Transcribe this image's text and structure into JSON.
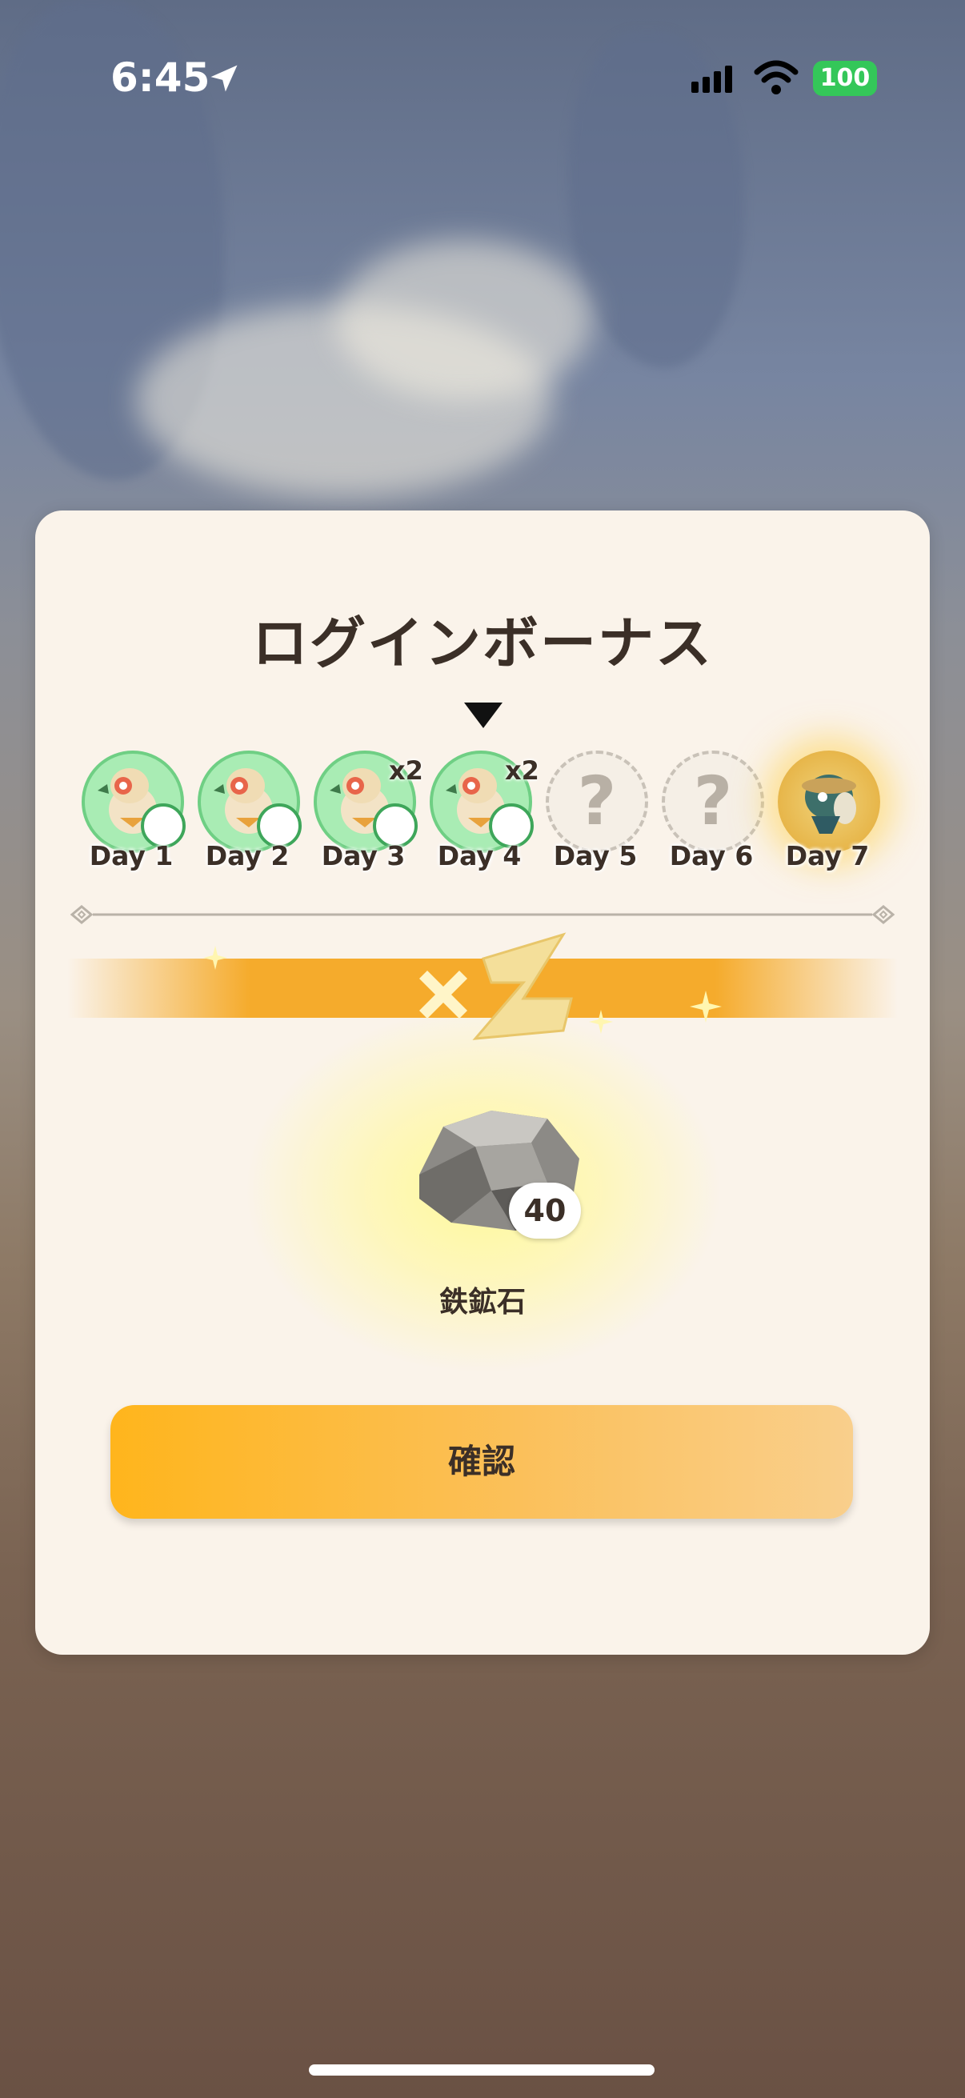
{
  "status_bar": {
    "time": "6:45",
    "battery": "100",
    "icons": [
      "location-arrow-icon",
      "cellular-signal-icon",
      "wifi-icon",
      "battery-icon"
    ]
  },
  "modal": {
    "title": "ログインボーナス",
    "days": [
      {
        "label": "Day 1",
        "state": "claimed",
        "multiplier": ""
      },
      {
        "label": "Day 2",
        "state": "claimed",
        "multiplier": ""
      },
      {
        "label": "Day 3",
        "state": "claimed",
        "multiplier": "x2"
      },
      {
        "label": "Day 4",
        "state": "current",
        "multiplier": "x2"
      },
      {
        "label": "Day 5",
        "state": "unknown",
        "mark": "?"
      },
      {
        "label": "Day 6",
        "state": "unknown",
        "mark": "?"
      },
      {
        "label": "Day 7",
        "state": "special"
      }
    ],
    "banner_multiplier": "×2",
    "reward": {
      "item_name": "鉄鉱石",
      "count": "40",
      "icon": "iron-ore-icon"
    },
    "confirm_label": "確認"
  },
  "colors": {
    "accent": "#f5ab2c",
    "panel": "#faf3ea",
    "text": "#3b2f27",
    "claimed": "#a9ecb4",
    "battery": "#34c759"
  }
}
